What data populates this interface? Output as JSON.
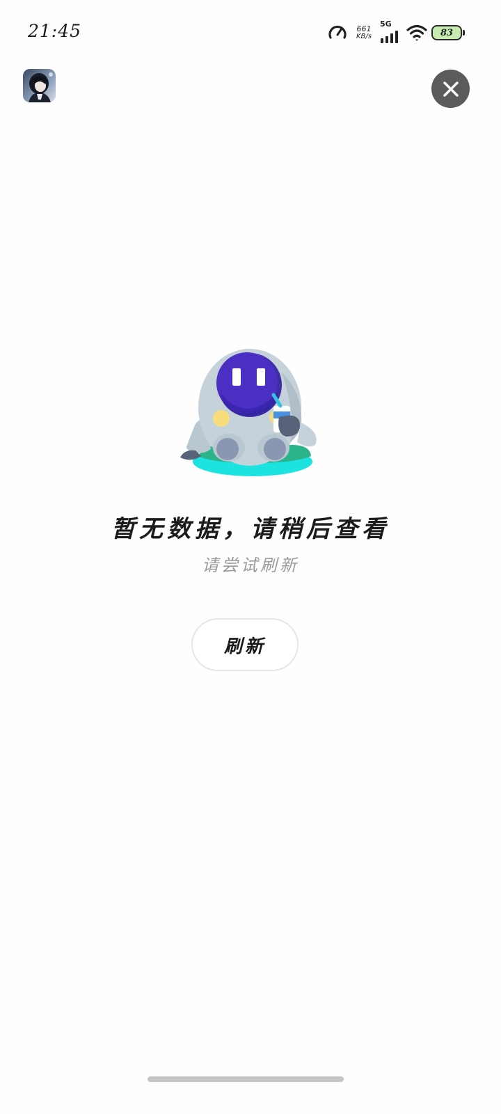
{
  "status_bar": {
    "time": "21:45",
    "net_speed_value": "661",
    "net_speed_unit": "KB/s",
    "network_type": "5G",
    "battery": "83",
    "icons": [
      "speedometer-icon",
      "signal-icon",
      "wifi-icon",
      "battery-icon"
    ],
    "battery_color": "#c7ecb1"
  },
  "header": {
    "avatar_icon": "app-avatar",
    "close_icon": "close-icon",
    "close_button_color": "#5b5b5b"
  },
  "empty_state": {
    "illustration": "robot-mascot-illustration",
    "title": "暂无数据，请稍后查看",
    "subtitle": "请尝试刷新",
    "refresh_label": "刷新"
  }
}
